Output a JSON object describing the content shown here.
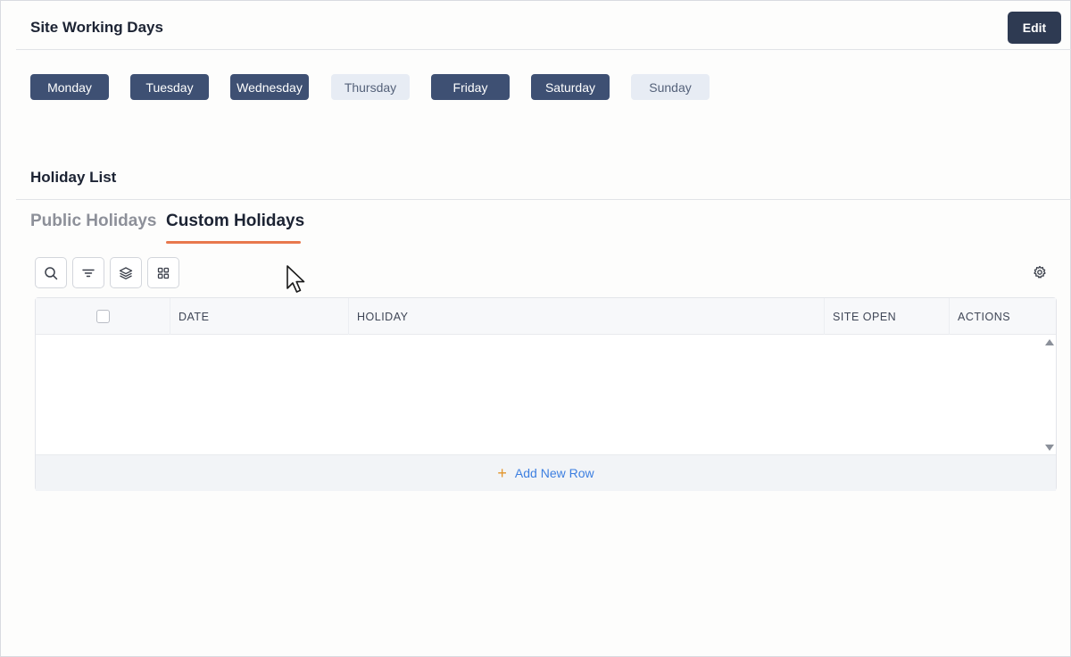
{
  "working_days": {
    "title": "Site Working Days",
    "edit_label": "Edit",
    "days": [
      {
        "label": "Monday",
        "active": true
      },
      {
        "label": "Tuesday",
        "active": true
      },
      {
        "label": "Wednesday",
        "active": true
      },
      {
        "label": "Thursday",
        "active": false
      },
      {
        "label": "Friday",
        "active": true
      },
      {
        "label": "Saturday",
        "active": true
      },
      {
        "label": "Sunday",
        "active": false
      }
    ]
  },
  "holidays": {
    "title": "Holiday List",
    "tabs": [
      {
        "label": "Public Holidays",
        "selected": false
      },
      {
        "label": "Custom Holidays",
        "selected": true
      }
    ],
    "toolbar": {
      "icons": [
        "search-icon",
        "filter-icon",
        "layers-icon",
        "grid-icon"
      ],
      "settings_icon": "gear-icon"
    },
    "table": {
      "columns": [
        "DATE",
        "HOLIDAY",
        "SITE OPEN",
        "ACTIONS"
      ],
      "rows": [],
      "add_row_label": "Add New Row",
      "add_row_icon": "+"
    }
  },
  "colors": {
    "active_day": "#3e5073",
    "inactive_day": "#e7ecf4",
    "primary_button": "#2e3a52",
    "tab_underline": "#e8784d",
    "link": "#3d7fe0",
    "plus_icon": "#e2952c"
  }
}
